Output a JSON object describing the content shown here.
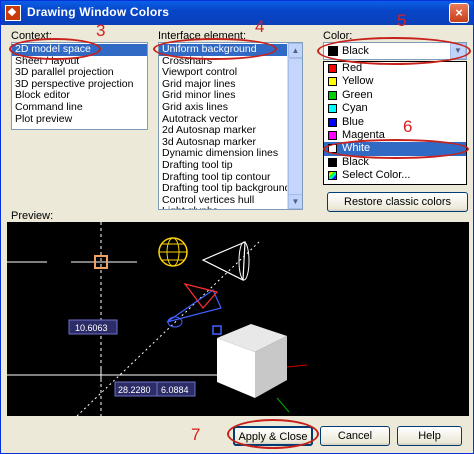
{
  "window": {
    "title": "Drawing Window Colors",
    "close_glyph": "×"
  },
  "context": {
    "label": "Context:",
    "items": [
      "2D model space",
      "Sheet / layout",
      "3D parallel projection",
      "3D perspective projection",
      "Block editor",
      "Command line",
      "Plot preview"
    ],
    "selected_index": 0
  },
  "interface": {
    "label": "Interface element:",
    "items": [
      "Uniform background",
      "Crosshairs",
      "Viewport control",
      "Grid major lines",
      "Grid minor lines",
      "Grid axis lines",
      "Autotrack vector",
      "2d Autosnap marker",
      "3d Autosnap marker",
      "Dynamic dimension lines",
      "Drafting tool tip",
      "Drafting tool tip contour",
      "Drafting tool tip background",
      "Control vertices hull",
      "Light glyphs"
    ],
    "selected_index": 0
  },
  "color": {
    "label": "Color:",
    "selected": "Black",
    "selected_hex": "#000000",
    "options": [
      {
        "name": "Red",
        "hex": "#ff0000"
      },
      {
        "name": "Yellow",
        "hex": "#ffff00"
      },
      {
        "name": "Green",
        "hex": "#00cc00"
      },
      {
        "name": "Cyan",
        "hex": "#00ffff"
      },
      {
        "name": "Blue",
        "hex": "#0000ff"
      },
      {
        "name": "Magenta",
        "hex": "#ff00ff"
      },
      {
        "name": "White",
        "hex": "#ffffff"
      },
      {
        "name": "Black",
        "hex": "#000000"
      },
      {
        "name": "Select Color...",
        "hex": "multi"
      }
    ],
    "highlighted_index": 6
  },
  "buttons": {
    "restore": "Restore classic colors",
    "apply": "Apply & Close",
    "cancel": "Cancel",
    "help": "Help"
  },
  "preview": {
    "label": "Preview:",
    "dim1": "10.6063",
    "dim2": "28.2280",
    "dim3": "6.0884"
  },
  "annotations": [
    "3",
    "4",
    "5",
    "6",
    "7"
  ],
  "accent": "#316ac5",
  "annotation_color": "#d62020"
}
